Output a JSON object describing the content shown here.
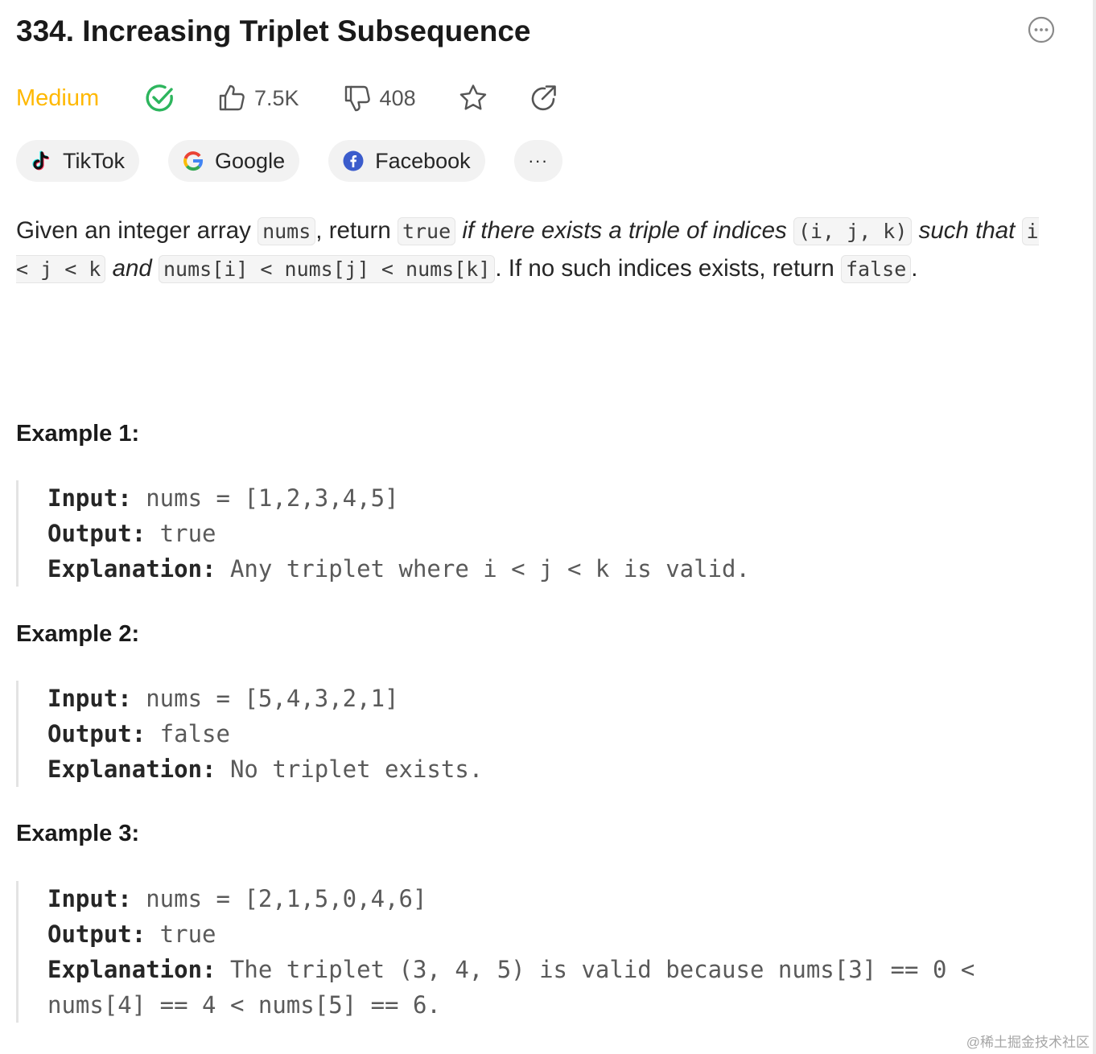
{
  "header": {
    "title": "334. Increasing Triplet Subsequence"
  },
  "meta": {
    "difficulty": "Medium",
    "likes": "7.5K",
    "dislikes": "408",
    "colors": {
      "difficulty": "#ffb800",
      "solved": "#2db55d"
    }
  },
  "tags": [
    {
      "label": "TikTok",
      "icon": "tiktok-icon"
    },
    {
      "label": "Google",
      "icon": "google-icon"
    },
    {
      "label": "Facebook",
      "icon": "facebook-icon"
    },
    {
      "label": "···",
      "icon": "more-icon"
    }
  ],
  "description": {
    "t1": "Given an integer array ",
    "c1": "nums",
    "t2": ", return ",
    "c2": "true",
    "t3": " ",
    "e1": "if there exists a triple of indices",
    "t4": " ",
    "c3": "(i, j, k)",
    "t5": " ",
    "e2": "such that",
    "t6": " ",
    "c4": "i < j < k",
    "t7": " ",
    "e3": "and",
    "t8": " ",
    "c5": "nums[i] < nums[j] < nums[k]",
    "t9": ". If no such indices exists, return ",
    "c6": "false",
    "t10": "."
  },
  "examples": [
    {
      "title": "Example 1:",
      "input_label": "Input:",
      "input": " nums = [1,2,3,4,5]",
      "output_label": "Output:",
      "output": " true",
      "explanation_label": "Explanation:",
      "explanation": " Any triplet where i < j < k is valid."
    },
    {
      "title": "Example 2:",
      "input_label": "Input:",
      "input": " nums = [5,4,3,2,1]",
      "output_label": "Output:",
      "output": " false",
      "explanation_label": "Explanation:",
      "explanation": " No triplet exists."
    },
    {
      "title": "Example 3:",
      "input_label": "Input:",
      "input": " nums = [2,1,5,0,4,6]",
      "output_label": "Output:",
      "output": " true",
      "explanation_label": "Explanation:",
      "explanation": " The triplet (3, 4, 5) is valid because nums[3] == 0 < nums[4] == 4 < nums[5] == 6."
    }
  ],
  "watermark": "@稀土掘金技术社区"
}
